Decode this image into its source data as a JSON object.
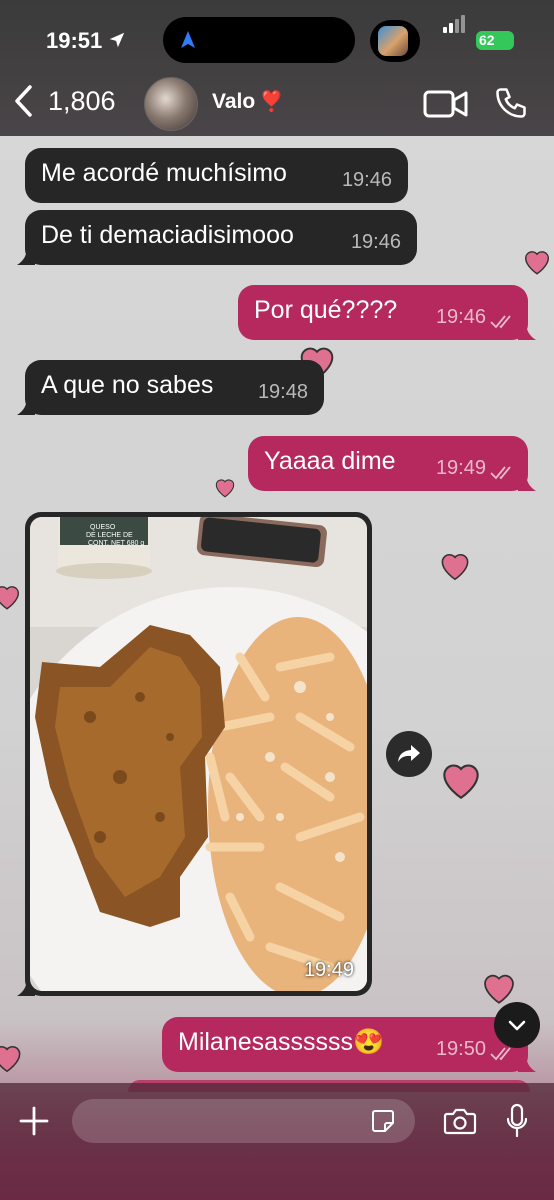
{
  "status_bar": {
    "time": "19:51",
    "battery": "62"
  },
  "header": {
    "back_count": "1,806",
    "contact_name": "Valo",
    "contact_emoji": "❣️"
  },
  "messages": [
    {
      "dir": "in",
      "text": "Me acordé muchísimo",
      "time": "19:46"
    },
    {
      "dir": "in",
      "text": "De ti demaciadisimooo",
      "time": "19:46"
    },
    {
      "dir": "out",
      "text": "Por qué????",
      "time": "19:46"
    },
    {
      "dir": "in",
      "text": "A que no sabes",
      "time": "19:48"
    },
    {
      "dir": "out",
      "text": "Yaaaa dime",
      "time": "19:49"
    },
    {
      "dir": "in",
      "type": "image",
      "time": "19:49"
    },
    {
      "dir": "out",
      "text": "Milanesassssss😍",
      "time": "19:50"
    }
  ],
  "photo": {
    "label_line1": "QUESO",
    "label_line2": "DE LECHE DE",
    "label_line3": "CONT. NET 680 g"
  },
  "colors": {
    "incoming": "#262626",
    "outgoing": "#b5295e",
    "heart": "#e0708f"
  },
  "icons": [
    "location-arrow-icon",
    "navigation-icon",
    "signal-icon",
    "battery-icon",
    "back-chevron-icon",
    "video-call-icon",
    "phone-icon",
    "forward-icon",
    "chevron-down-icon",
    "plus-icon",
    "sticker-icon",
    "camera-icon",
    "microphone-icon",
    "read-ticks-icon"
  ]
}
